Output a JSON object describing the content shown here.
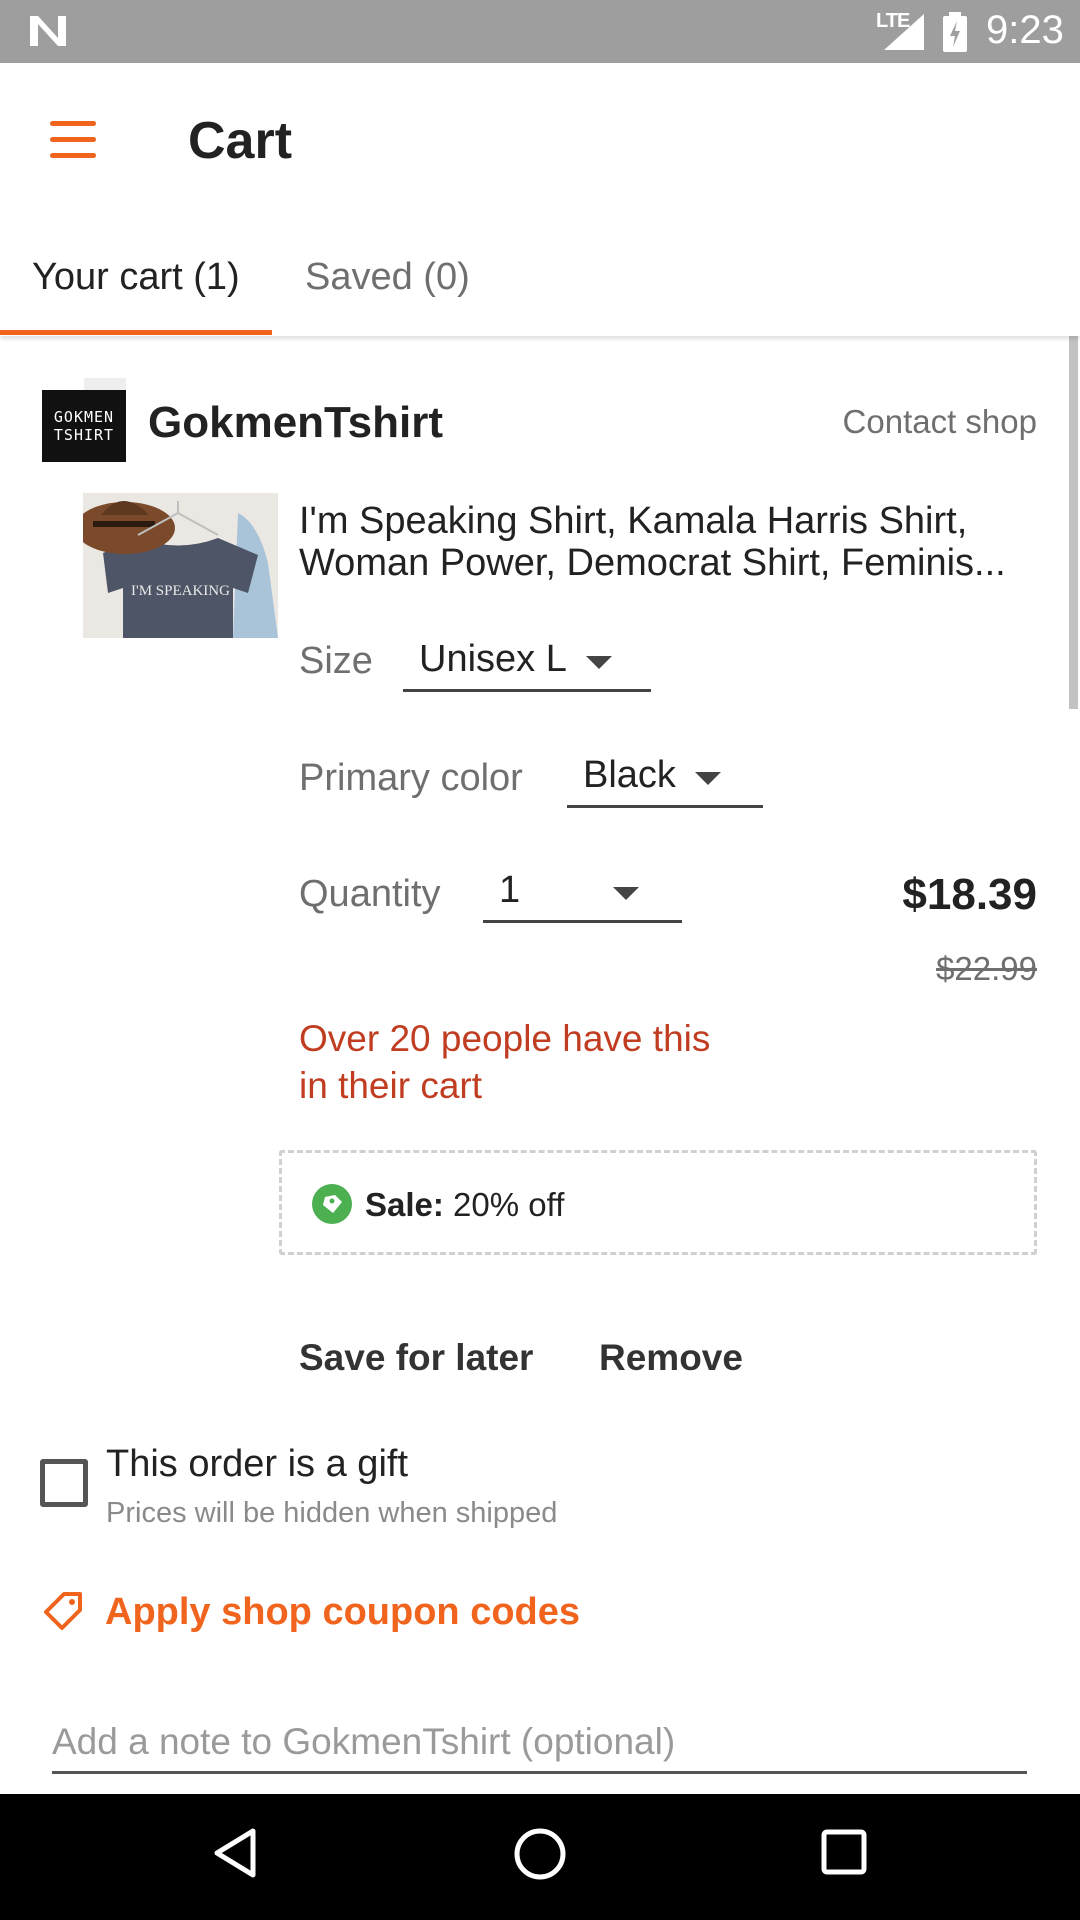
{
  "status_bar": {
    "network": "LTE",
    "time": "9:23",
    "icons": [
      "n-logo-icon",
      "signal-icon",
      "battery-charging-icon"
    ]
  },
  "app_bar": {
    "menu_icon": "hamburger-menu-icon",
    "title": "Cart"
  },
  "tabs": [
    {
      "label": "Your cart (1)",
      "active": true
    },
    {
      "label": "Saved (0)",
      "active": false
    }
  ],
  "shop": {
    "logo_text_line1": "GOKMEN",
    "logo_text_line2": "TSHIRT",
    "name": "GokmenTshirt",
    "contact_label": "Contact shop"
  },
  "item": {
    "image_text": "I'M SPEAKING",
    "title_line1": "I'm Speaking Shirt, Kamala Harris Shirt,",
    "title_line2": "Woman Power, Democrat Shirt, Feminis...",
    "size_label": "Size",
    "size_value": "Unisex L",
    "color_label": "Primary color",
    "color_value": "Black",
    "quantity_label": "Quantity",
    "quantity_value": "1",
    "price": "$18.39",
    "original_price": "$22.99",
    "demand_line1": "Over 20 people have this",
    "demand_line2": "in their cart",
    "sale_label": "Sale:",
    "sale_value": "20% off",
    "save_for_later": "Save for later",
    "remove": "Remove"
  },
  "gift": {
    "label": "This order is a gift",
    "sublabel": "Prices will be hidden when shipped",
    "checked": false
  },
  "coupon": {
    "label": "Apply shop coupon codes"
  },
  "note": {
    "placeholder": "Add a note to GokmenTshirt (optional)",
    "value": ""
  },
  "colors": {
    "accent": "#f1641e",
    "demand_text": "#c13d21",
    "sale_icon": "#4caf50",
    "status_bar": "#9e9e9e"
  },
  "nav_bar": {
    "icons": [
      "back-icon",
      "home-icon",
      "recents-icon"
    ]
  }
}
